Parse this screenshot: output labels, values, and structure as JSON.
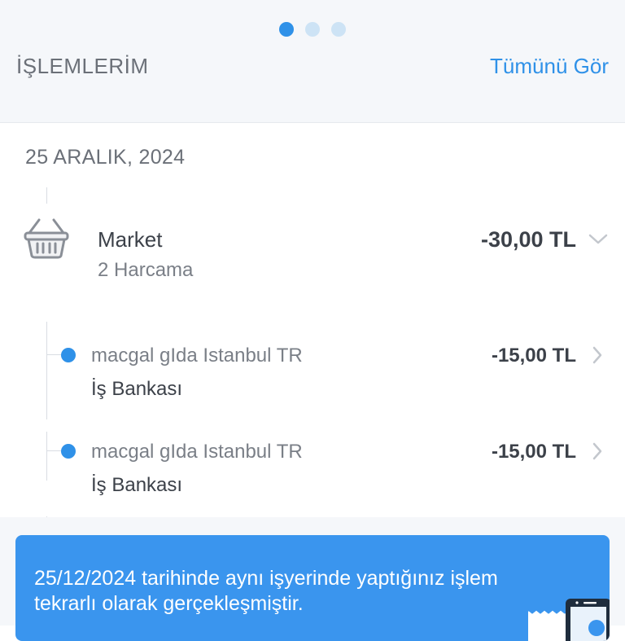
{
  "header": {
    "pager": {
      "count": 3,
      "active_index": 0
    },
    "title": "İŞLEMLERİM",
    "see_all_label": "Tümünü Gör"
  },
  "date_group": {
    "date": "25 ARALIK, 2024"
  },
  "category": {
    "icon": "shopping-basket-icon",
    "name": "Market",
    "subtitle": "2 Harcama",
    "amount": "-30,00 TL"
  },
  "transactions": [
    {
      "merchant": "macgal gIda Istanbul TR",
      "bank": "İş Bankası",
      "amount": "-15,00 TL"
    },
    {
      "merchant": "macgal gIda Istanbul TR",
      "bank": "İş Bankası",
      "amount": "-15,00 TL"
    }
  ],
  "banner": {
    "text": "25/12/2024 tarihinde aynı işyerinde yaptığınız işlem tekrarlı olarak gerçekleşmiştir.",
    "icon": "phone-receipt-icon"
  },
  "colors": {
    "accent": "#2f91e8",
    "banner_bg": "#3a95ee",
    "text_dark": "#3c4149",
    "text_muted": "#7a7f87",
    "header_bg": "#f5f7fa"
  }
}
